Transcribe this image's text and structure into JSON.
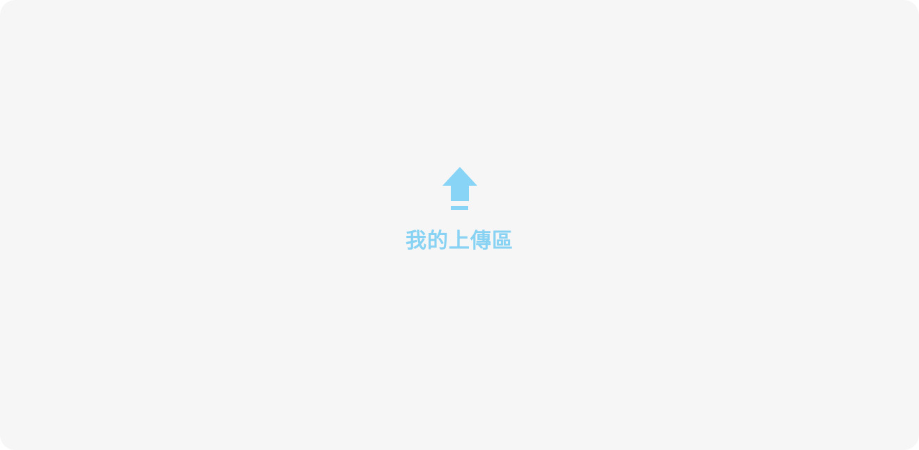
{
  "upload_area": {
    "icon": "upload-arrow-icon",
    "label": "我的上傳區",
    "accent_color": "#87d4f7",
    "label_color": "#88d2f3",
    "background_color": "#f6f6f6"
  }
}
